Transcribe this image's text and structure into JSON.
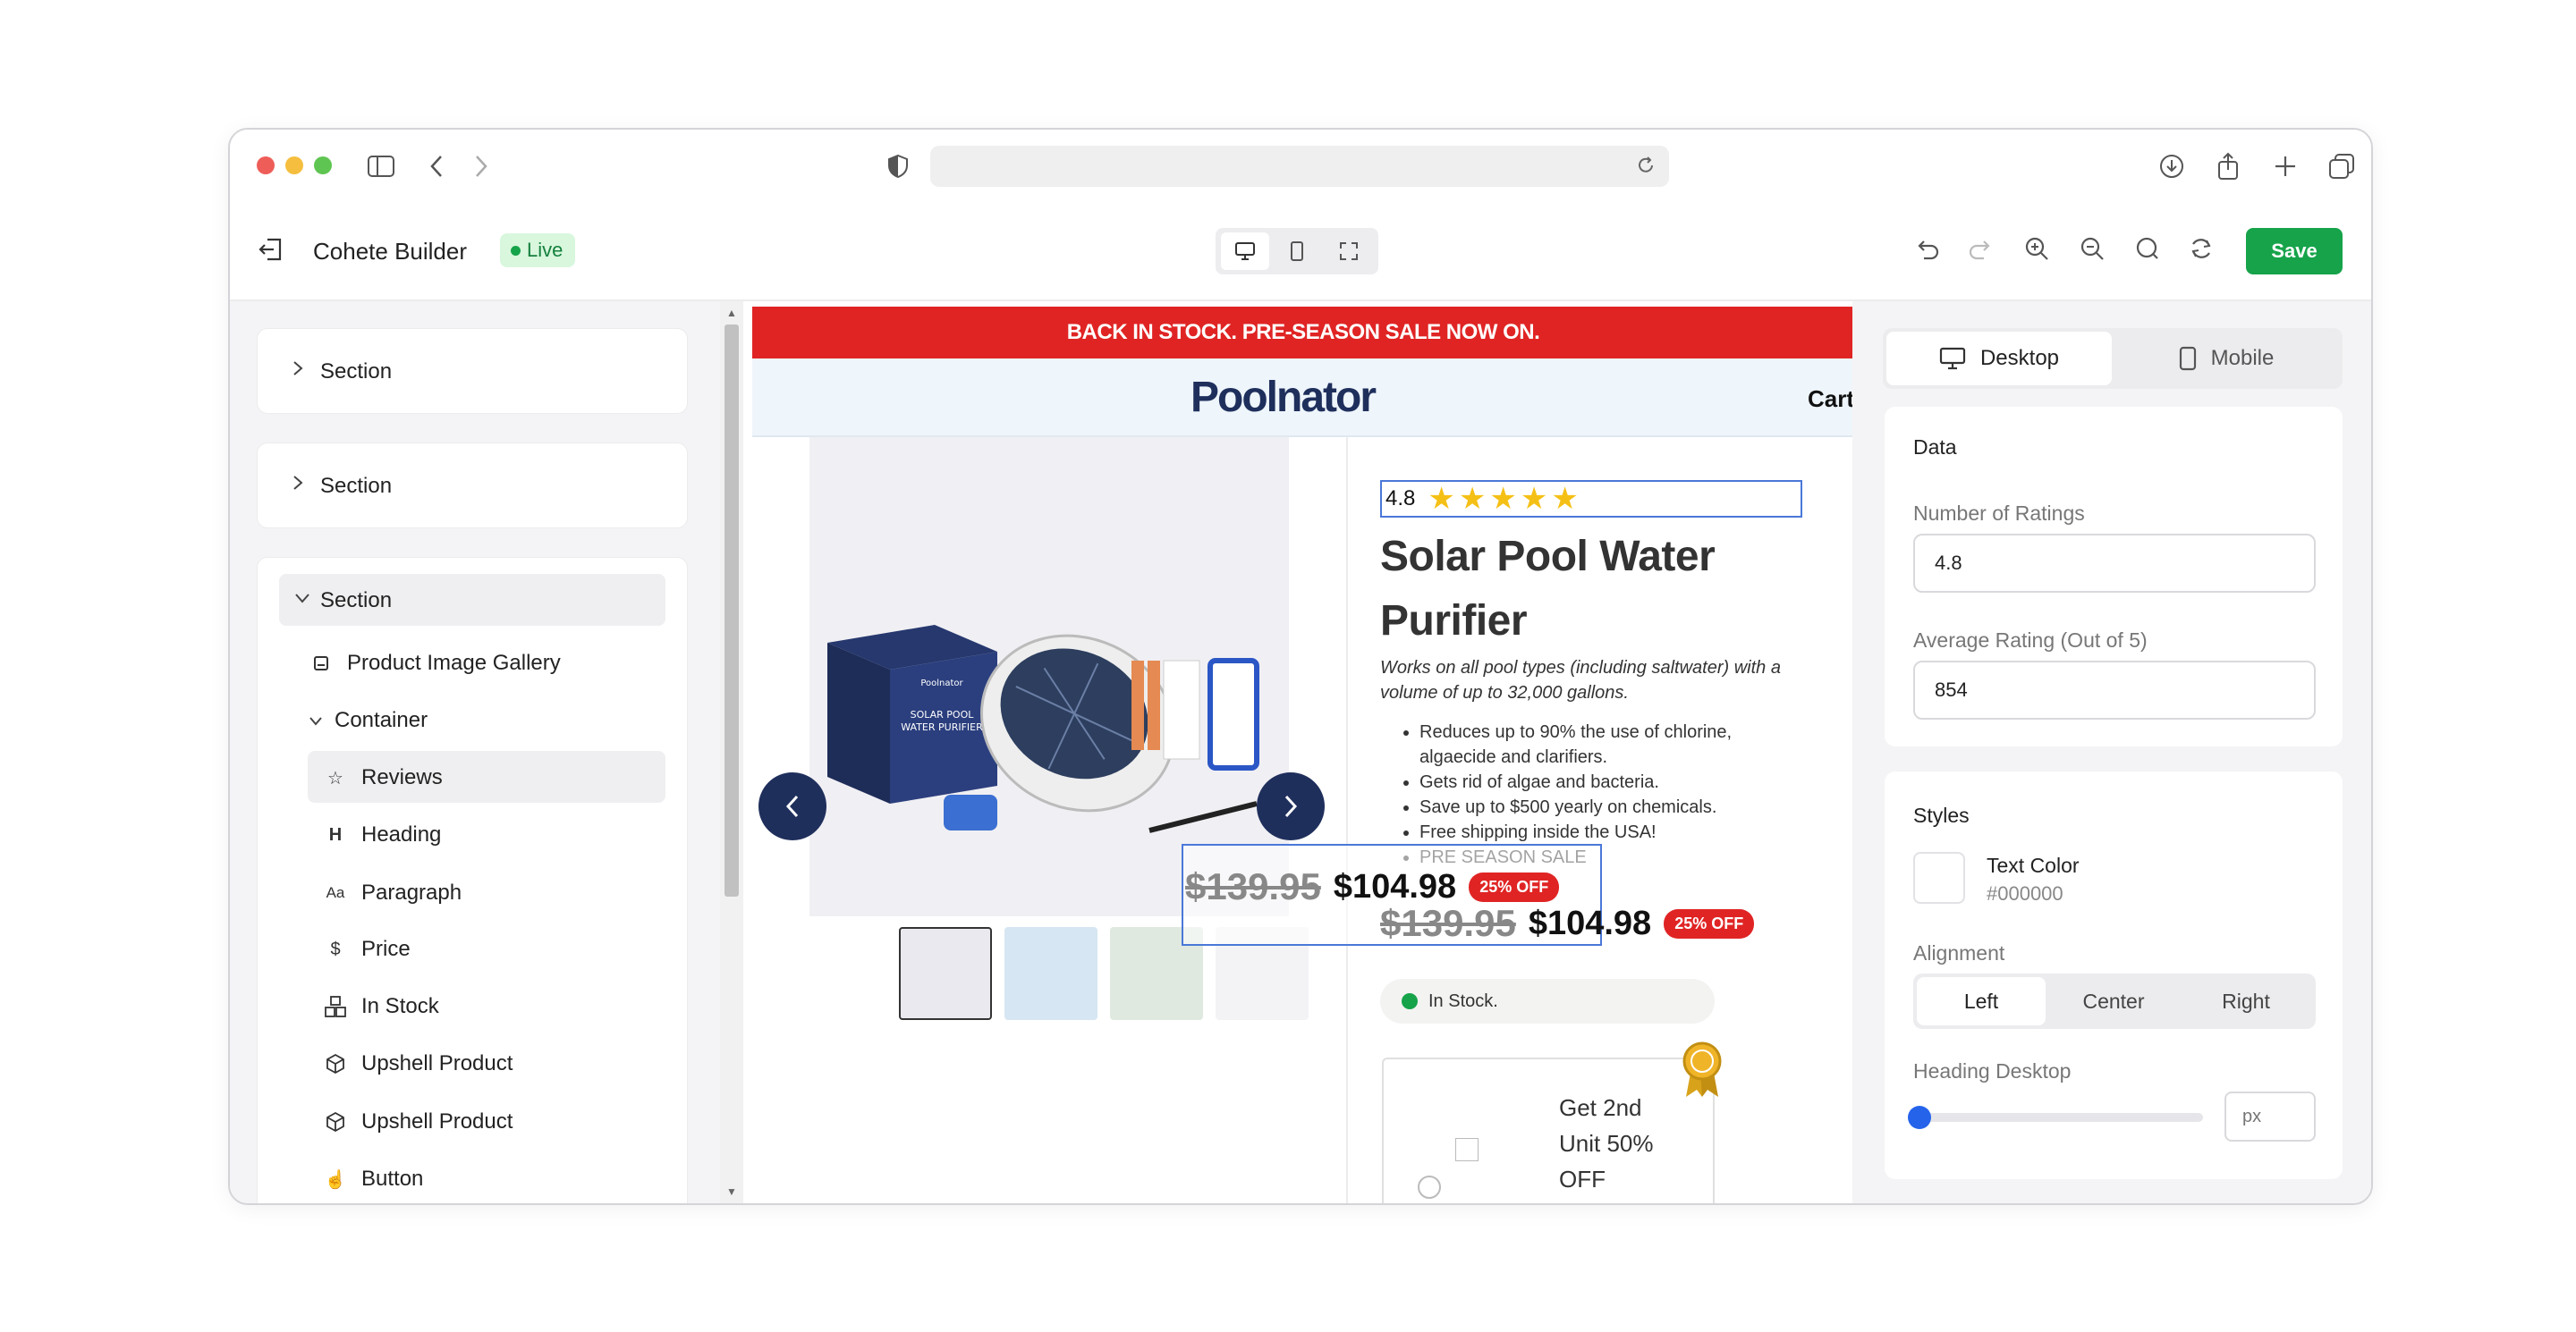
{
  "app": {
    "title": "Cohete Builder",
    "status": "Live",
    "save_label": "Save"
  },
  "outline": {
    "sections": [
      "Section",
      "Section",
      "Section"
    ],
    "children": {
      "gallery": "Product Image Gallery",
      "container": "Container",
      "items": [
        "Reviews",
        "Heading",
        "Paragraph",
        "Price",
        "In Stock",
        "Upshell Product",
        "Upshell Product",
        "Button"
      ]
    }
  },
  "preview": {
    "banner": "BACK IN STOCK. PRE-SEASON SALE NOW ON.",
    "brand": "Poolnator",
    "cart": "Cart",
    "rating": "4.8",
    "stars": 5,
    "title_line1": "Solar Pool Water",
    "title_line2": "Purifier",
    "subtitle": "Works on all pool types (including saltwater) with a volume of up to 32,000 gallons.",
    "bullets": [
      "Reduces up to 90% the use of chlorine, algaecide and clarifiers.",
      "Gets rid of algae and bacteria.",
      "Save up to $500 yearly on chemicals.",
      "Free shipping inside the USA!",
      "PRE SEASON SALE"
    ],
    "old_price": "$139.95",
    "new_price": "$104.98",
    "discount": "25% OFF",
    "stock": "In Stock.",
    "upsell_line1": "Get 2nd",
    "upsell_line2": "Unit 50%",
    "upsell_line3": "OFF",
    "product_box_line1": "SOLAR POOL",
    "product_box_line2": "WATER PURIFIER",
    "product_box_brand": "Poolnator"
  },
  "props": {
    "tabs": [
      "Desktop",
      "Mobile"
    ],
    "data_heading": "Data",
    "num_ratings_label": "Number of Ratings",
    "num_ratings_value": "4.8",
    "avg_rating_label": "Average Rating (Out of 5)",
    "avg_rating_value": "854",
    "styles_heading": "Styles",
    "text_color_label": "Text Color",
    "text_color_value": "#000000",
    "alignment_label": "Alignment",
    "alignment_options": [
      "Left",
      "Center",
      "Right"
    ],
    "heading_desktop_label": "Heading Desktop",
    "heading_desktop_placeholder": "px"
  },
  "colors": {
    "accent_green": "#16a34a",
    "banner_red": "#e02424",
    "brand_navy": "#1f2f5c",
    "star": "#f5c016"
  }
}
